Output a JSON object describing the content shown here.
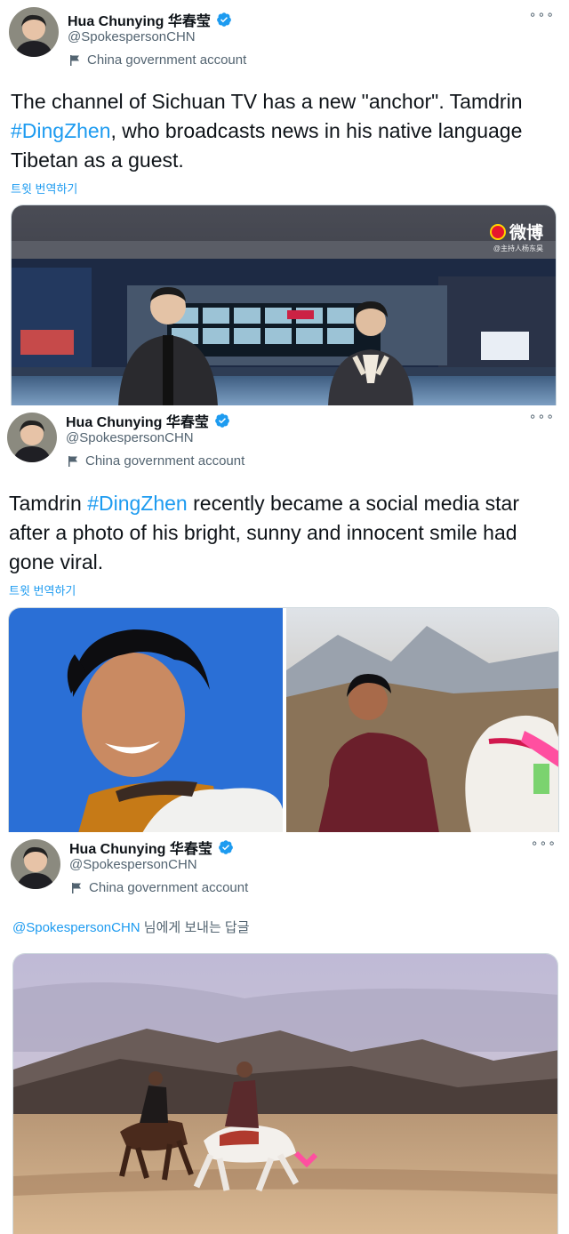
{
  "tweets": [
    {
      "name": "Hua Chunying 华春莹",
      "handle": "@SpokespersonCHN",
      "gov_label": "China government account",
      "more": "∘∘∘",
      "text_before": "The channel of Sichuan TV has a new \"anchor\". Tamdrin ",
      "hashtag": "#DingZhen",
      "text_after": ", who broadcasts news in his native language Tibetan as a guest.",
      "translate": "트윗 번역하기",
      "media": {
        "watermark": "微博",
        "watermark_sub": "@主持人杨东昊"
      }
    },
    {
      "name": "Hua Chunying 华春莹",
      "handle": "@SpokespersonCHN",
      "gov_label": "China government account",
      "more": "∘∘∘",
      "text_before": "Tamdrin ",
      "hashtag": "#DingZhen",
      "text_after": " recently became a social media star after a photo of his bright, sunny and innocent smile had gone viral.",
      "translate": "트윗 번역하기"
    },
    {
      "name": "Hua Chunying 华春莹",
      "handle": "@SpokespersonCHN",
      "gov_label": "China government account",
      "more": "∘∘∘",
      "reply_mention": "@SpokespersonCHN",
      "reply_suffix": " 님에게 보내는 답글"
    }
  ],
  "colors": {
    "link": "#1d9bf0",
    "secondary_text": "#536471",
    "verified": "#1d9bf0"
  }
}
